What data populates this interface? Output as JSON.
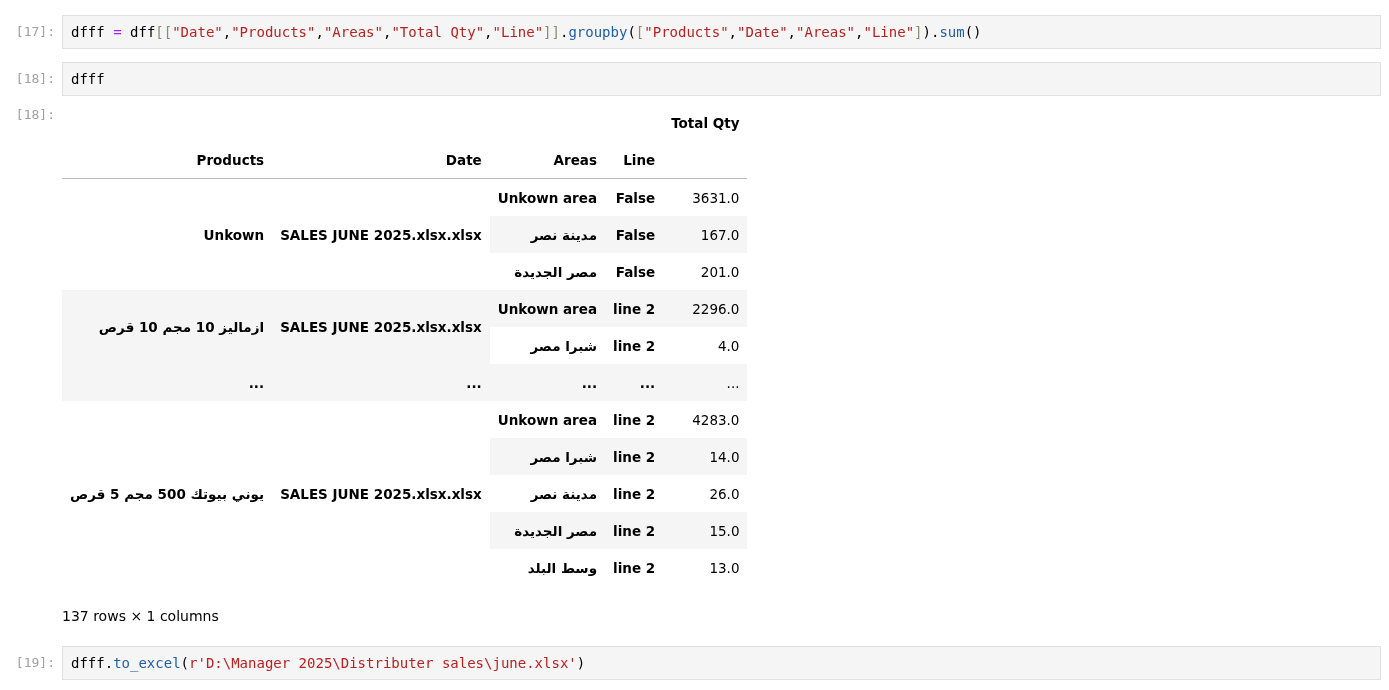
{
  "cells": [
    {
      "kind": "code",
      "prompt": "[17]:",
      "tokens": [
        {
          "kind": "plain",
          "text": "dfff "
        },
        {
          "kind": "op",
          "text": "="
        },
        {
          "kind": "plain",
          "text": " dff"
        },
        {
          "kind": "bracket",
          "text": "[["
        },
        {
          "kind": "string",
          "text": "\"Date\""
        },
        {
          "kind": "plain",
          "text": ","
        },
        {
          "kind": "string",
          "text": "\"Products\""
        },
        {
          "kind": "plain",
          "text": ","
        },
        {
          "kind": "string",
          "text": "\"Areas\""
        },
        {
          "kind": "plain",
          "text": ","
        },
        {
          "kind": "string",
          "text": "\"Total Qty\""
        },
        {
          "kind": "plain",
          "text": ","
        },
        {
          "kind": "string",
          "text": "\"Line\""
        },
        {
          "kind": "bracket",
          "text": "]]"
        },
        {
          "kind": "plain",
          "text": "."
        },
        {
          "kind": "method",
          "text": "groupby"
        },
        {
          "kind": "plain",
          "text": "("
        },
        {
          "kind": "bracket",
          "text": "["
        },
        {
          "kind": "string",
          "text": "\"Products\""
        },
        {
          "kind": "plain",
          "text": ","
        },
        {
          "kind": "string",
          "text": "\"Date\""
        },
        {
          "kind": "plain",
          "text": ","
        },
        {
          "kind": "string",
          "text": "\"Areas\""
        },
        {
          "kind": "plain",
          "text": ","
        },
        {
          "kind": "string",
          "text": "\"Line\""
        },
        {
          "kind": "bracket",
          "text": "]"
        },
        {
          "kind": "plain",
          "text": ")."
        },
        {
          "kind": "method",
          "text": "sum"
        },
        {
          "kind": "plain",
          "text": "()"
        }
      ]
    },
    {
      "kind": "code",
      "prompt": "[18]:",
      "tokens": [
        {
          "kind": "plain",
          "text": "dfff"
        }
      ]
    },
    {
      "kind": "output",
      "prompt": "[18]:",
      "table": {
        "value_column": "Total Qty",
        "index_names": [
          "Products",
          "Date",
          "Areas",
          "Line"
        ],
        "rows": [
          {
            "product": "Unkown",
            "date": "SALES JUNE 2025.xlsx.xlsx",
            "area": "Unkown area",
            "line": "False",
            "value": "3631.0"
          },
          {
            "area": "مدينة نصر",
            "line": "False",
            "value": "167.0"
          },
          {
            "area": "مصر الجديدة",
            "line": "False",
            "value": "201.0"
          },
          {
            "product": "ازماليز 10 مجم 10 قرص",
            "date": "SALES JUNE 2025.xlsx.xlsx",
            "area": "Unkown area",
            "line": "line 2",
            "value": "2296.0"
          },
          {
            "area": "شبرا مصر",
            "line": "line 2",
            "value": "4.0"
          },
          {
            "product": "...",
            "date": "...",
            "area": "...",
            "line": "...",
            "value": "..."
          },
          {
            "product": "يوني بيوتك 500 مجم 5 قرص",
            "date": "SALES JUNE 2025.xlsx.xlsx",
            "area": "Unkown area",
            "line": "line 2",
            "value": "4283.0"
          },
          {
            "area": "شبرا مصر",
            "line": "line 2",
            "value": "14.0"
          },
          {
            "area": "مدينة نصر",
            "line": "line 2",
            "value": "26.0"
          },
          {
            "area": "مصر الجديدة",
            "line": "line 2",
            "value": "15.0"
          },
          {
            "area": "وسط البلد",
            "line": "line 2",
            "value": "13.0"
          }
        ]
      },
      "summary": "137 rows × 1 columns"
    },
    {
      "kind": "code",
      "prompt": "[19]:",
      "tokens": [
        {
          "kind": "plain",
          "text": "dfff."
        },
        {
          "kind": "method",
          "text": "to_excel"
        },
        {
          "kind": "plain",
          "text": "("
        },
        {
          "kind": "string",
          "text": "r'D:\\Manager 2025\\Distributer sales\\june.xlsx'"
        },
        {
          "kind": "plain",
          "text": ")"
        }
      ]
    }
  ]
}
